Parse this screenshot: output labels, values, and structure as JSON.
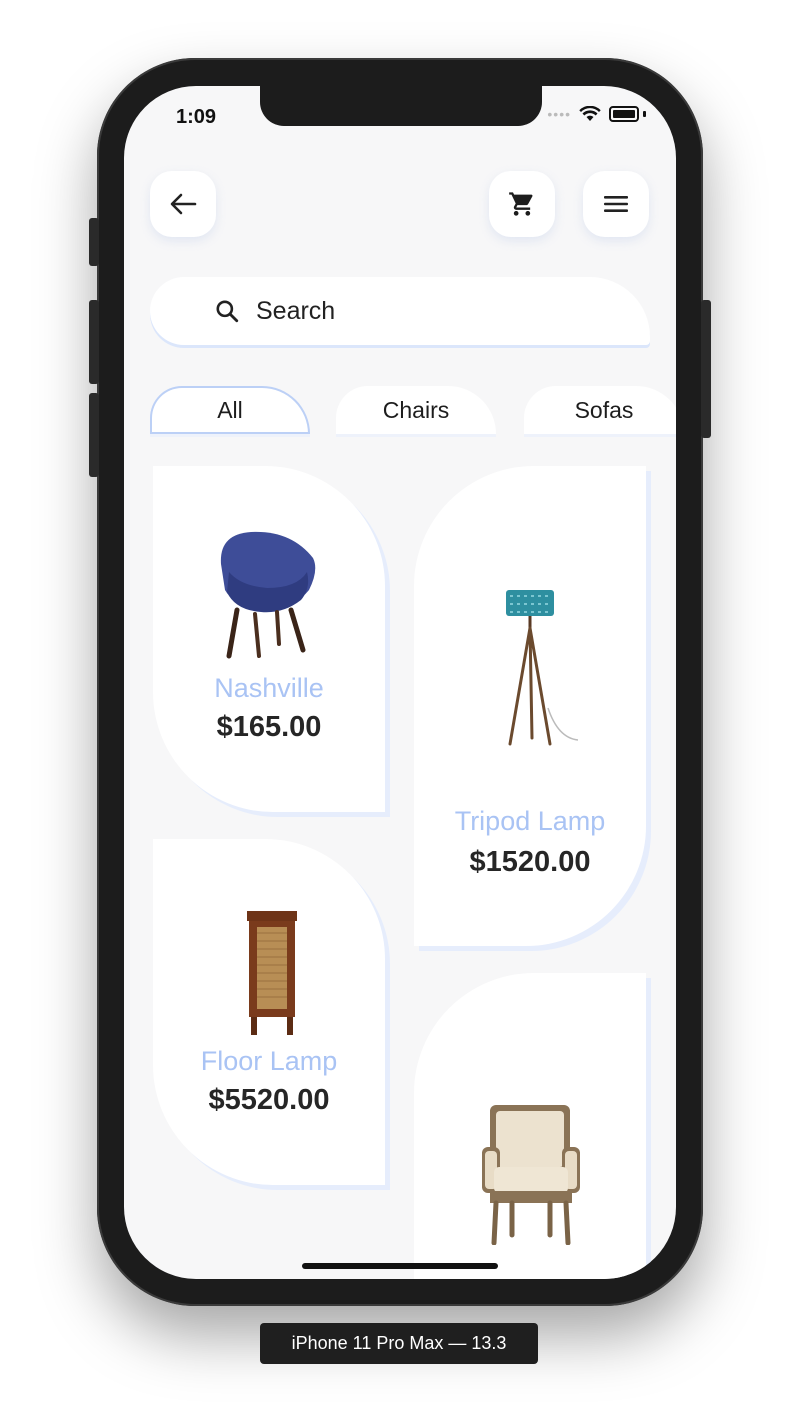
{
  "status": {
    "time": "1:09"
  },
  "search": {
    "placeholder": "Search"
  },
  "categories": [
    "All",
    "Chairs",
    "Sofas"
  ],
  "products": [
    {
      "name": "Nashville",
      "price": "$165.00"
    },
    {
      "name": "Tripod Lamp",
      "price": "$1520.00"
    },
    {
      "name": "Floor Lamp",
      "price": "$5520.00"
    },
    {
      "name": "",
      "price": ""
    }
  ],
  "device_label": "iPhone 11 Pro Max — 13.3",
  "colors": {
    "accent": "#a9c3f4",
    "card_shadow": "#e6edfc",
    "background": "#f7f7f8"
  },
  "icons": [
    "back-arrow-icon",
    "cart-icon",
    "menu-icon",
    "search-icon",
    "wifi-icon",
    "battery-icon"
  ]
}
